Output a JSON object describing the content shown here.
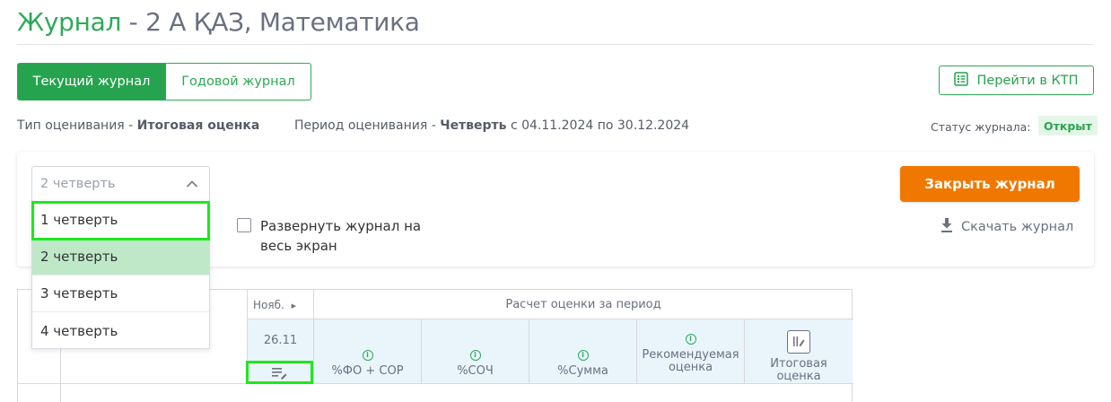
{
  "header": {
    "title_green": "Журнал",
    "title_rest": " - 2 А ҚАЗ, Математика"
  },
  "tabs": [
    {
      "label": "Текущий журнал",
      "active": true
    },
    {
      "label": "Годовой журнал",
      "active": false
    }
  ],
  "ktp_button": {
    "label": "Перейти в КТП",
    "icon": "list-icon"
  },
  "info": {
    "assessment_type_label": "Тип оценивания - ",
    "assessment_type_value": "Итоговая оценка",
    "period_label": "Период оценивания - ",
    "period_value": "Четверть",
    "period_range": " с 04.11.2024 по 30.12.2024",
    "status_label": "Статус журнала:",
    "status_value": "Открыт"
  },
  "quarter_select": {
    "value": "2 четверть",
    "options": [
      "1 четверть",
      "2 четверть",
      "3 четверть",
      "4 четверть"
    ],
    "selected_index": 1
  },
  "expand_checkbox": {
    "label": "Развернуть журнал на весь экран",
    "checked": false
  },
  "actions": {
    "close_journal": "Закрыть журнал",
    "download_journal": "Скачать журнал"
  },
  "table": {
    "month": "Нояб.",
    "date": "26.11",
    "calc_header": "Расчет оценки за период",
    "calc_columns": [
      {
        "label": "%ФО + СОР",
        "icon": "info-icon"
      },
      {
        "label": "%СОЧ",
        "icon": "info-icon"
      },
      {
        "label": "%Сумма",
        "icon": "info-icon"
      },
      {
        "label": "Рекомендуемая оценка",
        "icon": "info-icon"
      },
      {
        "label": "Итоговая оценка",
        "icon": "edit-grade-icon"
      }
    ]
  },
  "colors": {
    "brand_green": "#2eaa58",
    "accent_orange": "#f07800",
    "selected_option": "#bfe8c8",
    "highlight": "#1ee81e"
  }
}
